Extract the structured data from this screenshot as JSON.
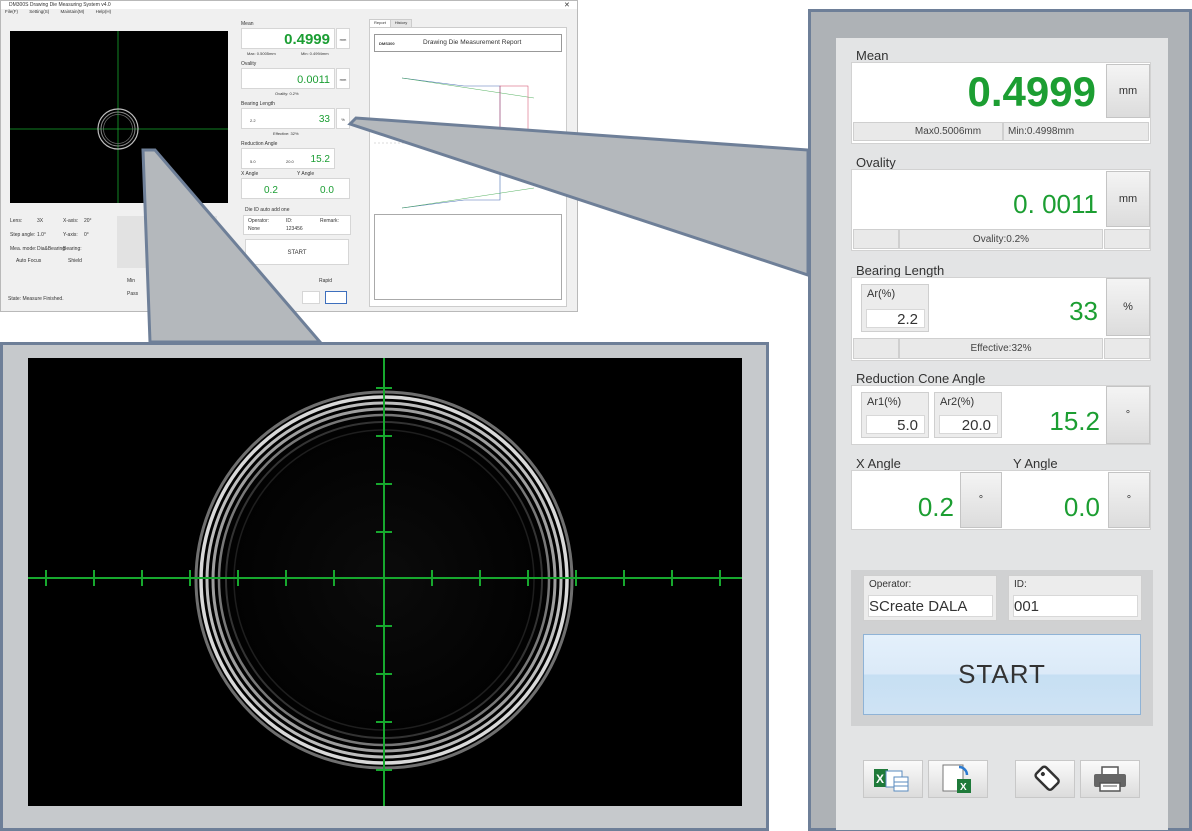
{
  "app": {
    "title": "DM300S Drawing Die Measuring System v4.0",
    "menu": [
      "File(F)",
      "Setting(S)",
      "Maintain(M)",
      "Help(H)"
    ],
    "mini": {
      "mean_label": "Mean",
      "mean_value": "0.4999",
      "mean_unit": "mm",
      "mean_max": "Max: 0.5005mm",
      "mean_min": "Min: 0.4994mm",
      "ovality_label": "Ovality",
      "ovality_value": "0.0011",
      "ovality_unit": "mm",
      "ovality_bar": "Ovality: 0.2%",
      "bearing_label": "Bearing Length",
      "bearing_ar": "2.2",
      "bearing_value": "33",
      "bearing_unit": "%",
      "bearing_bar": "Effective: 32%",
      "reduction_label": "Reduction Angle",
      "reduction_ar1": "5.0",
      "reduction_ar2": "20.0",
      "reduction_value": "15.2",
      "x_angle_label": "X Angle",
      "x_angle_value": "0.2",
      "y_angle_label": "Y Angle",
      "y_angle_value": "0.0",
      "auto_id_label": "Die ID auto add one",
      "operator_label": "Operator:",
      "operator_value": "None",
      "id_label": "ID:",
      "id_value": "123456",
      "remark_label": "Remark:",
      "start_label": "START",
      "lens_label": "Lens:",
      "lens_value": "3X",
      "xaxis_label": "X-axis:",
      "xaxis_value": "20°",
      "step_label": "Step angle:",
      "step_value": "1.0°",
      "yaxis_label": "Y-axis:",
      "yaxis_value": "0°",
      "mode_label": "Mea. mode:",
      "mode_value": "Dia&Bearing",
      "bearing_small": "Bearing:",
      "auto_focus": "Auto Focus",
      "shield": "Shield",
      "rapid": "Rapid",
      "min_label": "Min",
      "pass_label": "Pass",
      "status": "State: Measure Finished.",
      "report_tab": "Report",
      "history_tab": "History",
      "report_title": "Drawing Die Measurement Report",
      "report_brand": "DMS300"
    }
  },
  "panel": {
    "mean": {
      "label": "Mean",
      "value": "0.4999",
      "unit": "mm",
      "max": "Max0.5006mm",
      "min": "Min:0.4998mm"
    },
    "ovality": {
      "label": "Ovality",
      "value": "0. 0011",
      "unit": "mm",
      "bar": "Ovality:0.2%"
    },
    "bearing": {
      "label": "Bearing Length",
      "ar_label": "Ar(%)",
      "ar_value": "2.2",
      "value": "33",
      "unit": "%",
      "bar": "Effective:32%"
    },
    "reduction": {
      "label": "Reduction Cone Angle",
      "ar1_label": "Ar1(%)",
      "ar1_value": "5.0",
      "ar2_label": "Ar2(%)",
      "ar2_value": "20.0",
      "value": "15.2",
      "unit": "°"
    },
    "x_angle": {
      "label": "X Angle",
      "value": "0.2",
      "unit": "°"
    },
    "y_angle": {
      "label": "Y Angle",
      "value": "0.0",
      "unit": "°"
    },
    "operator": {
      "label": "Operator:",
      "value": "SCreate DALA"
    },
    "id": {
      "label": "ID:",
      "value": "001"
    },
    "start_label": "START",
    "icons": [
      "excel-export-icon",
      "excel-open-icon",
      "tag-icon",
      "printer-icon"
    ]
  },
  "colors": {
    "accent_green": "#1c9e32",
    "frame_blue": "#6e7f98",
    "crosshair": "#17a82e"
  }
}
